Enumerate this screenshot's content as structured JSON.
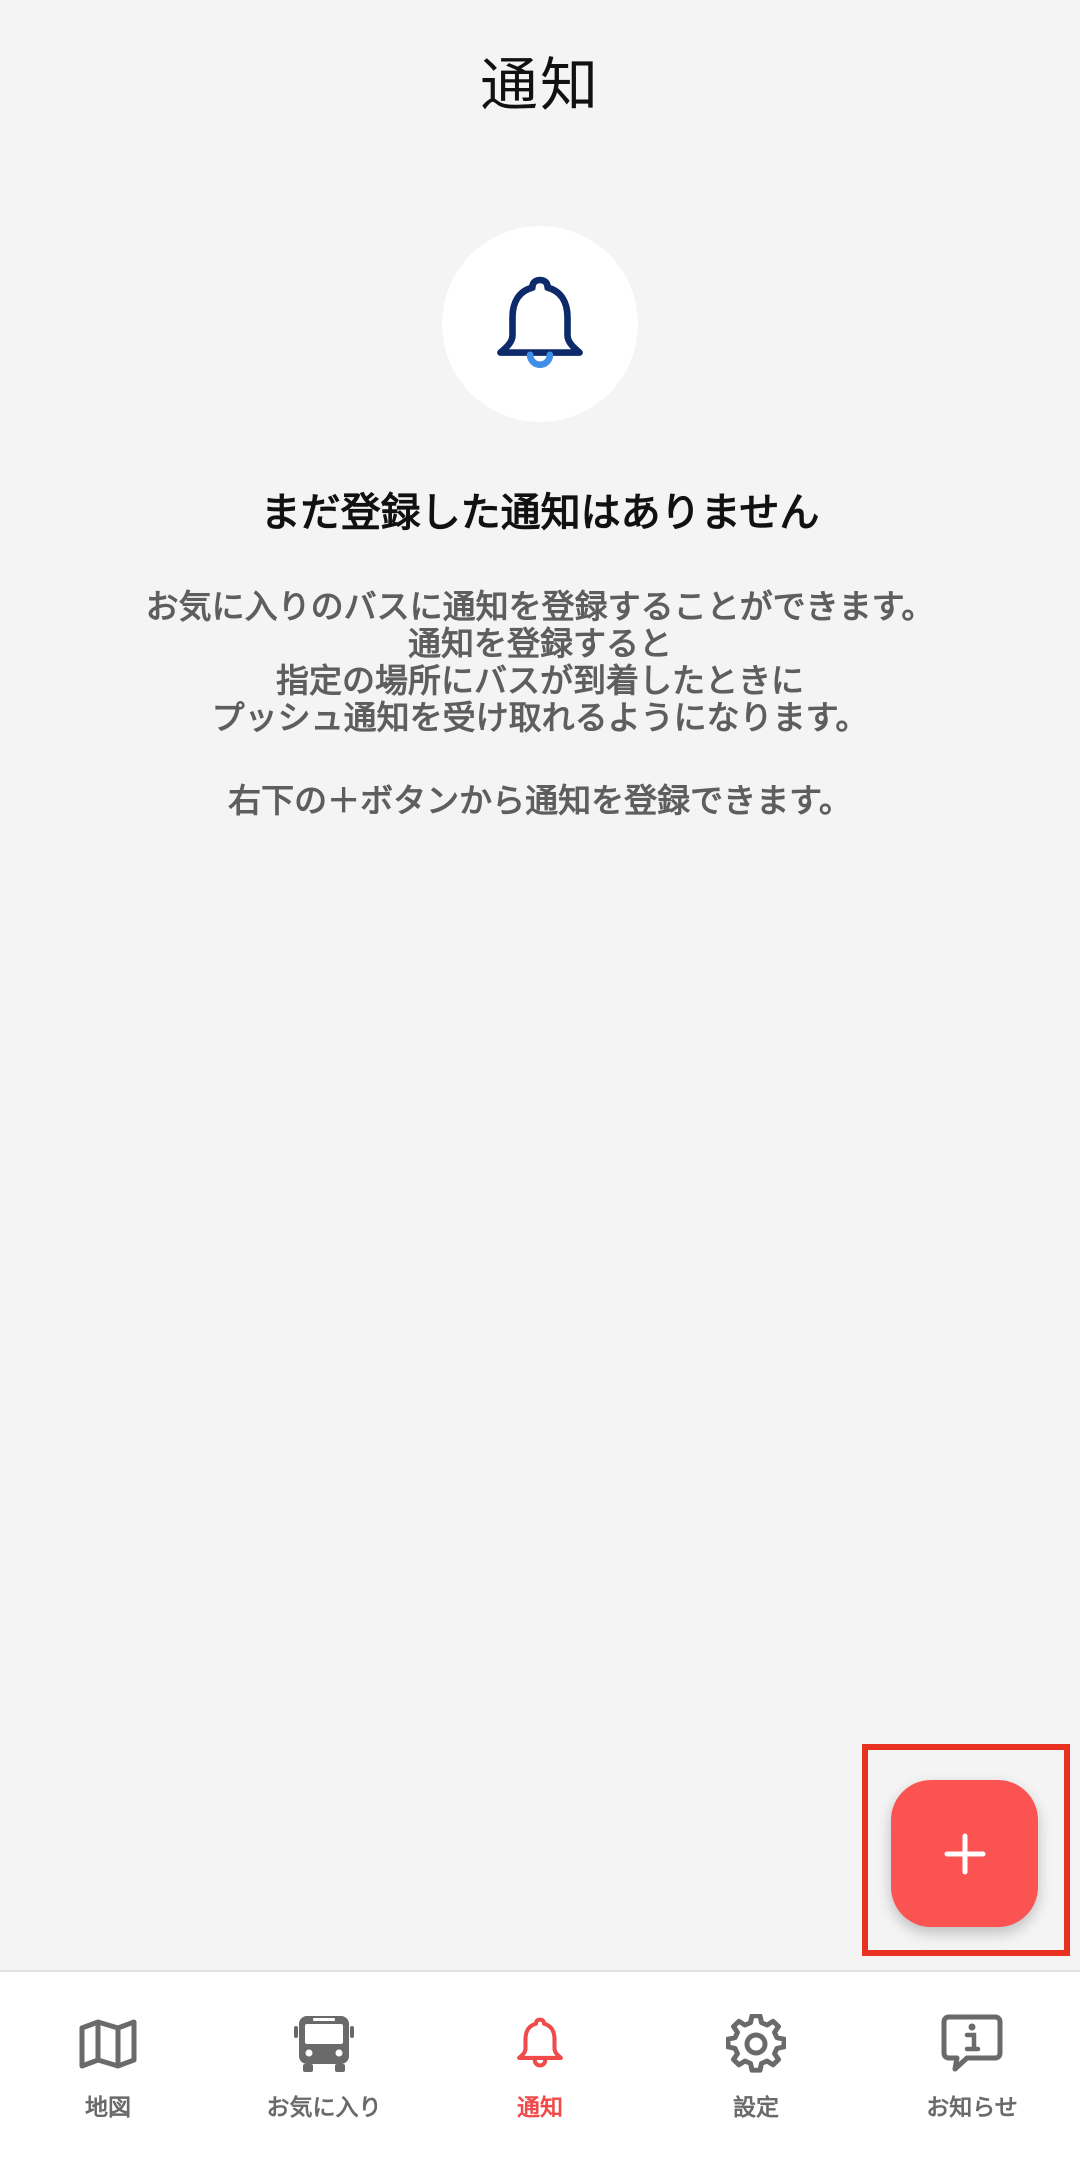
{
  "header": {
    "title": "通知"
  },
  "empty_state": {
    "icon": "bell-icon",
    "title": "まだ登録した通知はありません",
    "description_lines": [
      "お気に入りのバスに通知を登録することができます。",
      "通知を登録すると",
      "指定の場所にバスが到着したときに",
      "プッシュ通知を受け取れるようになります。"
    ],
    "hint": "右下の＋ボタンから通知を登録できます。"
  },
  "fab": {
    "icon": "plus-icon",
    "color": "#fb5252"
  },
  "tabbar": {
    "items": [
      {
        "label": "地図",
        "icon": "map-icon",
        "active": false
      },
      {
        "label": "お気に入り",
        "icon": "bus-icon",
        "active": false
      },
      {
        "label": "通知",
        "icon": "bell-icon",
        "active": true
      },
      {
        "label": "設定",
        "icon": "gear-icon",
        "active": false
      },
      {
        "label": "お知らせ",
        "icon": "info-bubble-icon",
        "active": false
      }
    ],
    "active_color": "#f14a4a",
    "inactive_color": "#6a6a6a"
  },
  "colors": {
    "background": "#f4f4f4",
    "bell_dark": "#0d2a6b",
    "bell_clapper": "#3f8ee8",
    "highlight_frame": "#e8311e"
  }
}
